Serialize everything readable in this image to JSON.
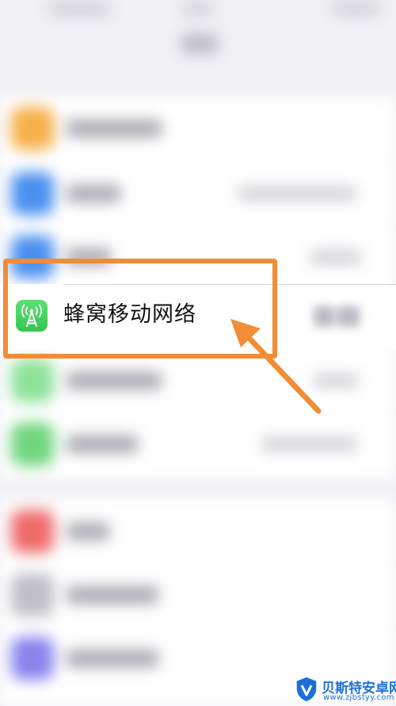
{
  "cellular_row": {
    "label": "蜂窝移动网络",
    "icon": "cellular-antenna-icon"
  },
  "watermark": {
    "title": "贝斯特安卓网",
    "url": "www.zjbstyy.com"
  },
  "colors": {
    "highlight": "#f28c37",
    "cellular_icon": "#4cd964",
    "watermark": "#1d6fd8"
  },
  "blurred_rows": [
    {
      "icon_color": "#f7b04a"
    },
    {
      "icon_color": "#4a90f0"
    },
    {
      "icon_color": "#4a90f0"
    },
    {
      "icon_color": "#8de29a"
    },
    {
      "icon_color": "#6fd67c"
    },
    {
      "icon_color": "#f06a6a"
    },
    {
      "icon_color": "#bfbfc6"
    },
    {
      "icon_color": "#8a83ee"
    }
  ]
}
